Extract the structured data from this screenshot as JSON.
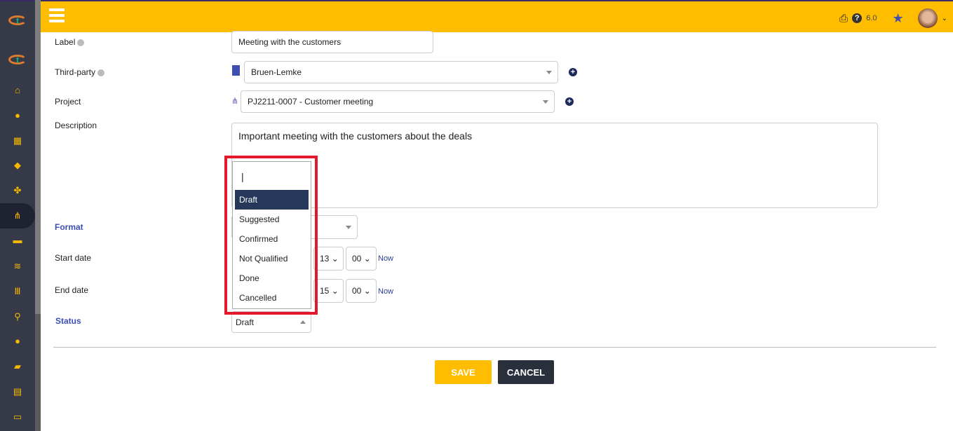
{
  "header": {
    "version": "6.0",
    "icons": [
      "print-icon",
      "help-icon",
      "star-icon",
      "avatar"
    ]
  },
  "sidebar": {
    "icons": [
      "home-icon",
      "user-icon",
      "building-icon",
      "box-icon",
      "cubes-icon",
      "project-icon",
      "briefcase-icon",
      "coins-icon",
      "bank-icon",
      "search-dollar-icon",
      "user-tie-icon",
      "folder-icon",
      "calendar-icon",
      "ticket-icon"
    ],
    "active": "project-icon",
    "logo_text": "t"
  },
  "form": {
    "label": {
      "label": "Label",
      "value": "Meeting with the customers"
    },
    "third_party": {
      "label": "Third-party",
      "value": "Bruen-Lemke"
    },
    "project": {
      "label": "Project",
      "value": "PJ2211-0007 - Customer meeting"
    },
    "description": {
      "label": "Description",
      "value": "Important meeting with the customers about the deals"
    },
    "format": {
      "label": "Format"
    },
    "start_date": {
      "label": "Start date",
      "hour": "13",
      "minute": "00",
      "now": "Now"
    },
    "end_date": {
      "label": "End date",
      "hour": "15",
      "minute": "00",
      "now": "Now"
    },
    "status": {
      "label": "Status",
      "value": "Draft",
      "options": [
        "Draft",
        "Suggested",
        "Confirmed",
        "Not Qualified",
        "Done",
        "Cancelled"
      ],
      "selected": "Draft"
    }
  },
  "buttons": {
    "save": "SAVE",
    "cancel": "CANCEL"
  },
  "colors": {
    "header": "#ffbd00",
    "sidebar": "#363a48",
    "highlight": "#e3192a",
    "selected": "#263859"
  }
}
